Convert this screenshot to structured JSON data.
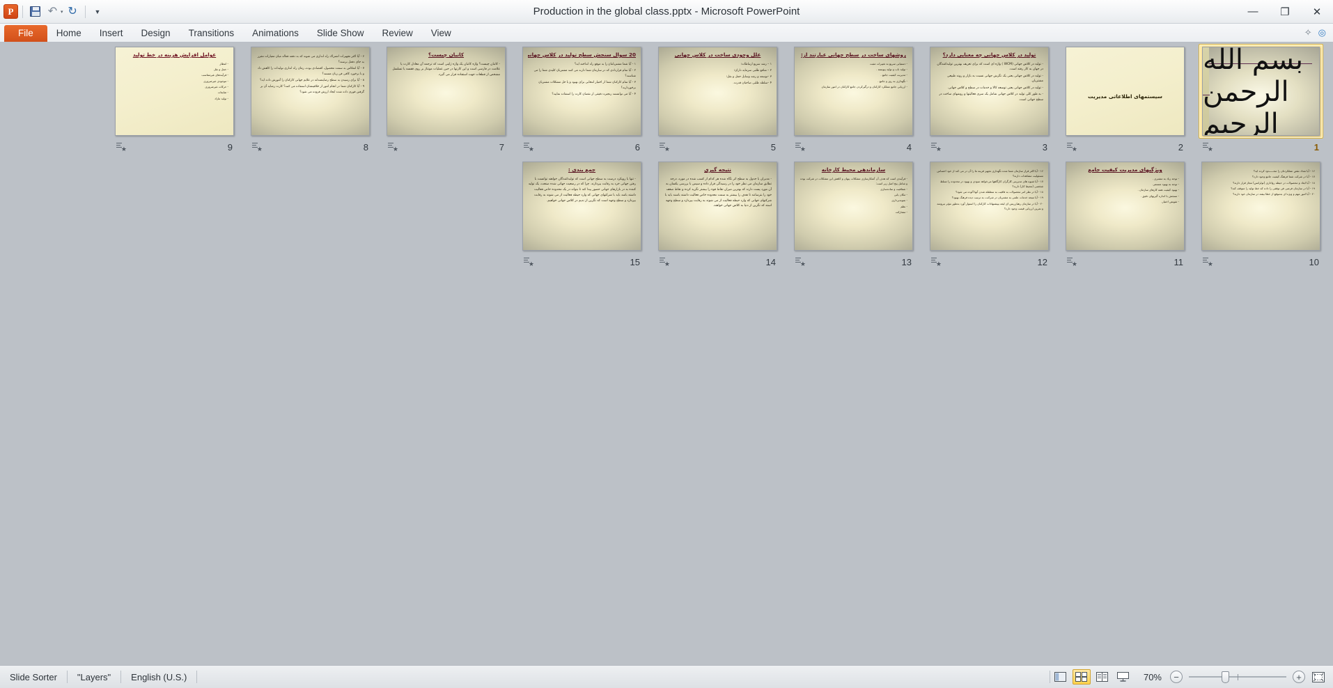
{
  "titlebar": {
    "app_icon": "powerpoint-logo",
    "document_title": "Production in the global class.pptx  -  Microsoft PowerPoint",
    "quick_access": [
      {
        "name": "save",
        "glyph": "save"
      },
      {
        "name": "undo",
        "glyph": "↶"
      },
      {
        "name": "redo",
        "glyph": "↻"
      },
      {
        "name": "customize-quick-access-toolbar",
        "glyph": "▼"
      }
    ],
    "window_controls": [
      {
        "name": "minimize",
        "glyph": "—"
      },
      {
        "name": "restore",
        "glyph": "❐"
      },
      {
        "name": "close",
        "glyph": "✕"
      }
    ]
  },
  "ribbon": {
    "file_tab": "File",
    "tabs": [
      "Home",
      "Insert",
      "Design",
      "Transitions",
      "Animations",
      "Slide Show",
      "Review",
      "View"
    ],
    "right_icons": [
      {
        "name": "minimize-ribbon-icon",
        "glyph": "✦"
      },
      {
        "name": "help-icon",
        "glyph": "?"
      }
    ]
  },
  "statusbar": {
    "view_name": "Slide Sorter",
    "theme_name": "\"Layers\"",
    "language": "English (U.S.)",
    "zoom_level": "70%",
    "view_buttons": [
      {
        "name": "normal-view",
        "active": false
      },
      {
        "name": "slide-sorter-view",
        "active": true
      },
      {
        "name": "reading-view",
        "active": false
      },
      {
        "name": "slide-show-view",
        "active": false
      }
    ],
    "zoom_out_label": "−",
    "zoom_in_label": "+",
    "fit_to_window_label": "fit-slide-to-window"
  },
  "slides": [
    {
      "number": "1",
      "selected": true,
      "surface": "title1",
      "kind": "calligraphy",
      "calligraphy": "بسم الله الرحمن الرحیم",
      "title": "",
      "body": []
    },
    {
      "number": "2",
      "selected": false,
      "surface": "light",
      "kind": "center",
      "center_text": "سیستمهای اطلاعاتی مدیریت",
      "title": "",
      "body": []
    },
    {
      "number": "3",
      "selected": false,
      "surface": "dark",
      "kind": "bullets",
      "title": "تولید در کلاس جهانی چه معنایی دارد؟",
      "body": [
        "تولید در کلاس جهانی (WCM ) واژه ای است که برای تعریف بهترین تولیدکنندگان در جهان به کار رفته است.",
        "تولید در کلاس جهانی یعنی یک نگرش جهانی نسبت به بازار و روند طبیعی مشتریان.",
        "تولید در کلاس جهانی یعنی توسعه کالا و خدمات در سطح و کلاس جهانی.",
        "به طور کلی تولید در کلاس جهانی شامل یک سری فعالیتها و روشهای ساخت در سطح جهانی است."
      ]
    },
    {
      "number": "4",
      "selected": false,
      "surface": "dark",
      "kind": "bullets",
      "title": "روشهای ساخت در سطح جهانی عبارتند از:",
      "body": [
        "دستیابی سریع به تغییرات  مثبت",
        "تولید ناب و تولید پیوسته .",
        "مدیریت کیفیت جامع .",
        "نگهداری به روز و جامع .",
        "ارزیابی جامع  عملکرد کارکنان و درگیرکردن جامع کارکنان در امور سازمان"
      ]
    },
    {
      "number": "5",
      "selected": false,
      "surface": "dark",
      "kind": "numbered",
      "title": "علل وجودی ساخت در کلاس جهانی",
      "body": [
        "۱ – رشد سریع ارتباطات؛",
        "۲ – منافع طلبی سرمایه داران؛",
        "۳ –توسعه و رشد وسایل حمل و نقل؛",
        "۴ –سلطه طلبی صاحبان قدرت."
      ]
    },
    {
      "number": "6",
      "selected": false,
      "surface": "dark",
      "kind": "numbered",
      "title": "20 سوال سنجش سطح تولید در کلاس جهانی:",
      "body": [
        "۱  - آیا شما مشتریانتان را به موقع راه انداخته اید؟",
        "۲  - آیا تمام قراردادی که در سازمان شما دارند می کنند مشتریان کلیدی شما را می شناسند؟",
        "۳  - آیا تمام کارکنان شما از اختیار انتخابی برای بهبود و یا حل مشکلات مشتریان برخوردارند؟",
        "۴  - آیا می توانستند زنجیره دقیقی از نقصان کارت را استفاده نمایید؟"
      ]
    },
    {
      "number": "7",
      "selected": false,
      "surface": "dark",
      "kind": "bullets",
      "title": "کانبان چیست؟",
      "body": [
        "کانبان چیست؟ واژه کانبان یک واژه ژاپنی است که ترجمه آن معادل کارت یا علامت در فارسی است و این کارتها در حین عملیات مونتاژ بر روی قفسه یا تسلسل مشخص از قطعات جهت استفاده قرار می گیرد."
      ]
    },
    {
      "number": "8",
      "selected": false,
      "surface": "dark",
      "kind": "numbered",
      "title": "",
      "body": [
        "۶ - آیا اکثر تجهیزات اشتراک راه اندازی می شوند که به دفعه فعاله میان معیارات مقرر به جای دفعل برسند؟",
        "۷ - آیا انعکاس به سمت محصول، اقتصادی بوده، زمان راه اندازی تولیدات را کاهش داد و با برخورد کافی فن زبان مستند؟",
        "۸ - آیا برای رسیدن به سطح رضایتمندانه در علایم جهانی کارکنان را آموزش داده اید؟",
        "۹ - آیا کارکنان شما در انجام امور از خلاقیتشان استفاده می کنند؟ کارت رضایه آن بر گرفتن فوری داده شده ایجاد ارزش فزوده می شود؟"
      ]
    },
    {
      "number": "9",
      "selected": false,
      "surface": "light",
      "kind": "bullets",
      "title": "عوامل افزایش هزینه در خط تولید",
      "body": [
        "انتظار",
        "حمل و نقل",
        "فرآیندهای غیرمتناسب",
        "موجودی غیرضروری",
        "حرکات غیرضروری",
        "ضایعات",
        "تولید مازاد"
      ]
    },
    {
      "number": "10",
      "selected": false,
      "surface": "dark",
      "kind": "numbered",
      "title": "",
      "body": [
        "۱۶ - آیا تعداد نقض عملکردتان را محـــــدود کرده اید؟",
        "۱۷ - آیا در شرکت شما فرهنگ کیفیت جامع وجود دارد؟",
        "۱۸ - آیا ابعاد و محصولات  در حیطه رواداری (تولرانس) مجاز قرار دارند؟",
        "۱۹ - آیا در سازمان فرضی فن توقفی را داده که خط تولید را متوقف کند؟",
        "۲۰ - آیا امور مهم و ویژه ای به‌موقع از خطا بیفتد در سازمان خود دارید؟"
      ]
    },
    {
      "number": "11",
      "selected": false,
      "surface": "dark",
      "kind": "bullets",
      "title": "ویژگیهای مدیریت کیفیت جامع",
      "body": [
        "توجه زیاد به مشتری .",
        "توجه به بهبود مستمر.",
        "بهبود کیفیت همه کارهای سازمان .",
        "سنجش با اندازه گیریهای دقیق .",
        "تفویض اختیار."
      ]
    },
    {
      "number": "12",
      "selected": false,
      "surface": "dark",
      "kind": "numbered",
      "title": "",
      "body": [
        "۱۶ - آیا اکثر قرار سازمان شما شده نگهداری تجهیز قرینه ما را آن در می کند از خود احساس مسئولیت مشاهدات دارند؟",
        "۱۷ - آیا شیوه های مدیریتی کارگران کارگاهها می‌خواهد سودی و بهبود در محدوده را تسلط شخصی (محیط کار) دارید؟",
        "۱۸ - آیا در نظر امر محصولات به فاقیت به سطقله شدن آنها آلوده می شود؟",
        "۱۹ - آیا نتیجه خدمات علمی به مشتریان در شرکت، به ترتیب دیده فرهنگ بهبود؟",
        "۲۰ - آیا در سازمان رهبازریس ای لیغه بپیشنهادات کارکنان را استوار آورد به‌طور مؤثر نیرومند و تمرین ارزیابی قیمت وجود دارد؟"
      ]
    },
    {
      "number": "13",
      "selected": false,
      "surface": "dark",
      "kind": "bullets",
      "title": "سازماندهی محیط کارخانه",
      "body": [
        "فرآیندی است که هدف آن آشکارسازی مشکلات پنهان و کاهش این مشکلات در شرکت بوده و شامل پنج اصل زیر است:",
        "شفافیت و ساده‌سازی",
        "مکان یابی",
        "نمونه‌برداری",
        "نظم",
        "مشارکت"
      ]
    },
    {
      "number": "14",
      "selected": false,
      "surface": "dark",
      "kind": "bullets",
      "title": "نتیجه گیری",
      "body": [
        "مدیران با جدول به سطح اثر نگاه شده هر کدام از کسب شده در مورد، درجه تطابق سازمان می نظر خود را در رسیدگی قرار داده و سپس با بررسی یکسان به آن مورد پست دارند که بهترین میزان نقاط قوه را بیشتر نگرید کرده و نقاط ضعف خود را بترسانند تا هدف را بیشتر به سمت معدوده خاص فعالیت داشته باشند باید با شرکتهای جهانی که وارد حیطه فعالیت از می شوند  به رقابت بپردازد و سطح وجهه استه که نگرین از دنیا به کلاس جهانی خواهند.",
        ""
      ]
    },
    {
      "number": "15",
      "selected": false,
      "surface": "dark",
      "kind": "bullets",
      "title": "جمع بندی :",
      "body": [
        "تنها با رویکرد درست به سطح جهانی است که تولیدکنندگان خواهند توانست با رفتن جهانی خرد به رقابت بپردازند. چرا که در رضعیت جهانی شده صنعت، یک تولید کننده به در بازارهای جهانی حضور پیدا کند تا بتواند در یک محدوده خاص فعالیت داشته باشد باید با شرکتهای جهانی که وارد حیطه فعالیت از می شوند به رقابت بپردازد و سطح وجهه است که نگرین از ندیم در کلاس جهانی خواهیم."
      ]
    }
  ]
}
